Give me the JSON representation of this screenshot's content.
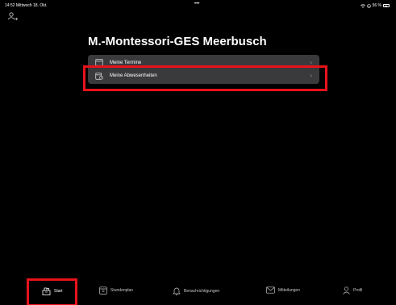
{
  "status": {
    "time_date": "14:52  Mittwoch 18. Okt.",
    "dots": "•••",
    "battery": "56 %",
    "battery_level": 0.56
  },
  "header": {
    "title": "M.-Montessori-GES Meerbusch"
  },
  "menu": {
    "items": [
      {
        "label": "Meine Termine",
        "icon": "calendar-icon"
      },
      {
        "label": "Meine Abwesenheiten",
        "icon": "absence-calendar-icon"
      }
    ]
  },
  "tabs": [
    {
      "label": "Start",
      "icon": "home-icon",
      "active": true
    },
    {
      "label": "Stundenplan",
      "icon": "timetable-icon",
      "active": false
    },
    {
      "label": "Benachrichtigungen",
      "icon": "bell-icon",
      "active": false
    },
    {
      "label": "Mitteilungen",
      "icon": "envelope-icon",
      "active": false
    },
    {
      "label": "Profil",
      "icon": "person-icon",
      "active": false
    }
  ],
  "colors": {
    "background": "#000000",
    "menu_bg": "#3a3a3c",
    "highlight": "#e8121b"
  }
}
